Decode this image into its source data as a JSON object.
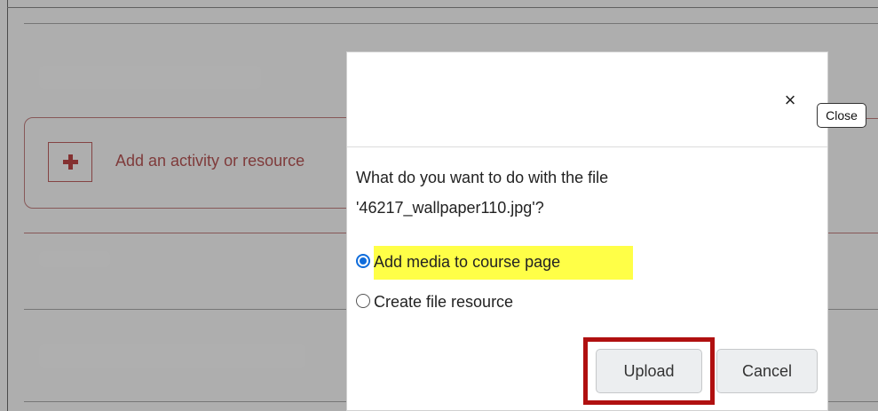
{
  "background": {
    "add_activity_label": "Add an activity or resource"
  },
  "dialog": {
    "close_icon": "×",
    "close_tooltip": "Close",
    "question": "What do you want to do with the file '46217_wallpaper110.jpg'?",
    "options": [
      {
        "label": "Add media to course page",
        "selected": true
      },
      {
        "label": "Create file resource",
        "selected": false
      }
    ],
    "upload_label": "Upload",
    "cancel_label": "Cancel"
  },
  "colors": {
    "accent": "#0f6cdb",
    "highlight": "#ffff47",
    "annotation_box": "#b01010",
    "add_activity": "#a83a3a"
  }
}
